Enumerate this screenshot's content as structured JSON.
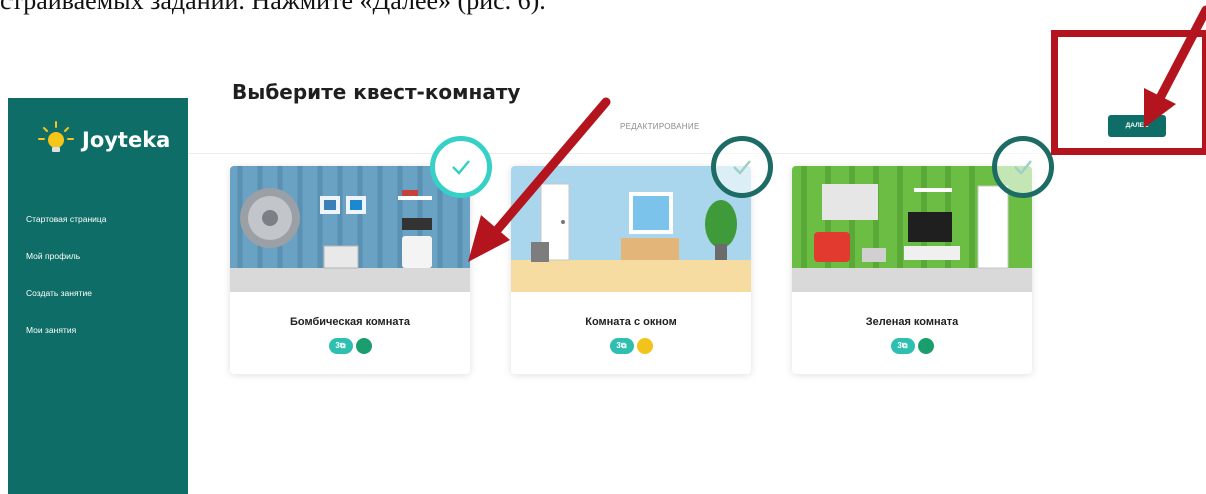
{
  "document_text": "страиваемых заданий. Нажмите «Далее» (рис. 6).",
  "app": {
    "logo_text": "Joyteka",
    "nav": [
      {
        "label": "Стартовая страница"
      },
      {
        "label": "Мой профиль"
      },
      {
        "label": "Создать занятие"
      },
      {
        "label": "Мои занятия"
      }
    ],
    "topbar_title": "РЕДАКТИРОВАНИЕ",
    "next_button": "ДАЛЕЕ",
    "heading": "Выберите квест-комнату"
  },
  "rooms": [
    {
      "title": "Бомбическая комната",
      "badge_label": "3",
      "level_color": "#1b9e6e",
      "selected": true,
      "check_color": "#35d0c6"
    },
    {
      "title": "Комната с окном",
      "badge_label": "3",
      "level_color": "#f2c31a",
      "selected": false,
      "check_color": "#1c6b64"
    },
    {
      "title": "Зеленая комната",
      "badge_label": "3",
      "level_color": "#1b9e6e",
      "selected": false,
      "check_color": "#1c6b64"
    }
  ],
  "colors": {
    "brand": "#0e6e67",
    "badge": "#2fbfb0",
    "annotation": "#b3141d"
  },
  "icons": [
    "bulb-icon",
    "check-icon",
    "puzzle-icon",
    "annotation-arrow"
  ]
}
